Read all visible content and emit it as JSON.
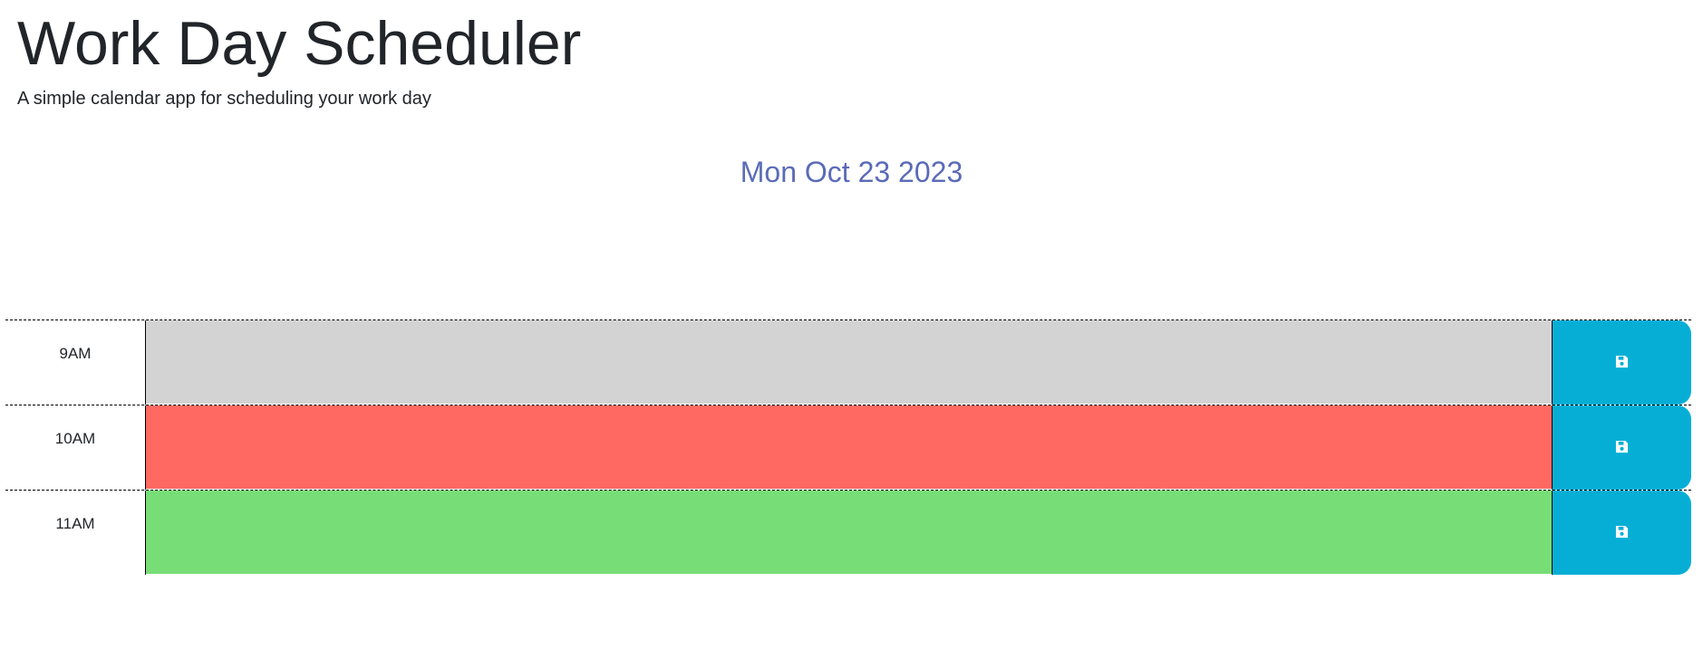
{
  "header": {
    "title": "Work Day Scheduler",
    "subtitle": "A simple calendar app for scheduling your work day",
    "current_day": "Mon Oct 23 2023"
  },
  "colors": {
    "past": "#d3d3d3",
    "present": "#ff6961",
    "future": "#77dd77",
    "save_button": "#06aed5",
    "date_text": "#5a6bb8"
  },
  "time_blocks": [
    {
      "hour": "9AM",
      "status": "past",
      "text": "",
      "save_icon": "floppy-disk-icon"
    },
    {
      "hour": "10AM",
      "status": "present",
      "text": "",
      "save_icon": "floppy-disk-icon"
    },
    {
      "hour": "11AM",
      "status": "future",
      "text": "",
      "save_icon": "floppy-disk-icon"
    }
  ]
}
